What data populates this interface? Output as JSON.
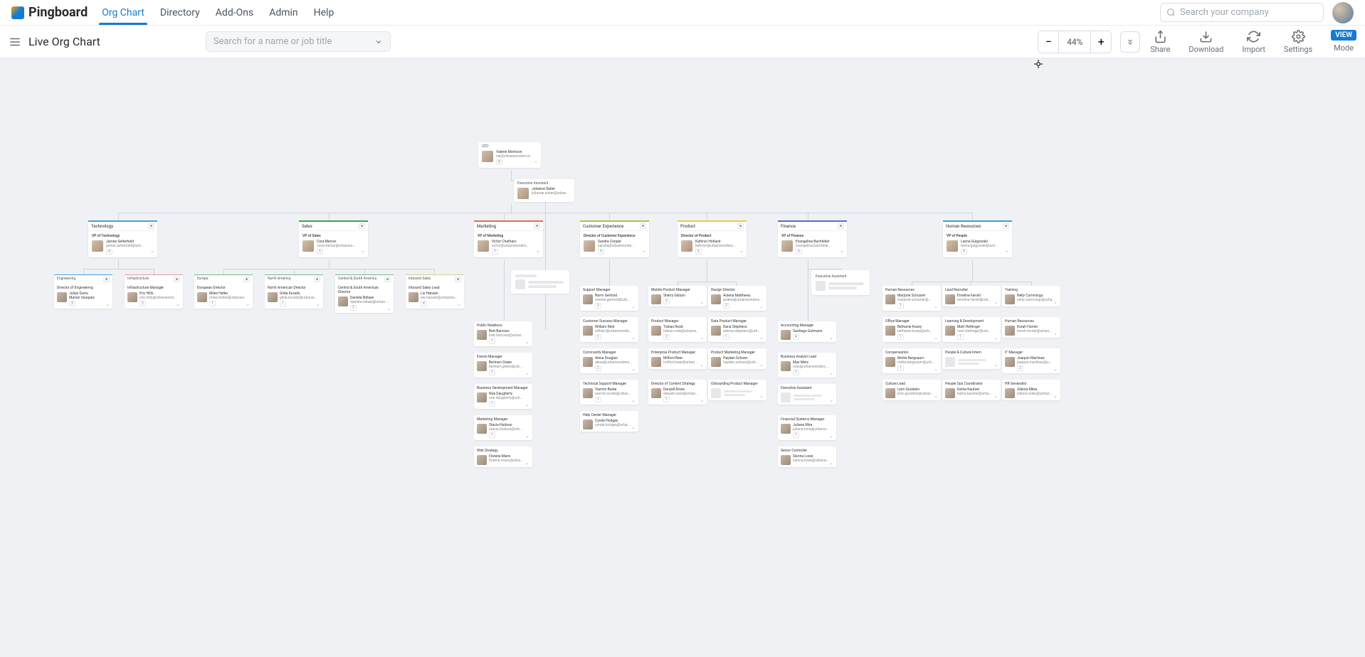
{
  "app": {
    "name": "Pingboard"
  },
  "nav": {
    "links": [
      "Org Chart",
      "Directory",
      "Add-Ons",
      "Admin",
      "Help"
    ],
    "search_placeholder": "Search your company"
  },
  "toolbar": {
    "title": "Live Org Chart",
    "search_placeholder": "Search for a name or job title",
    "zoom": "44%",
    "actions": {
      "share": "Share",
      "download": "Download",
      "import": "Import",
      "settings": "Settings",
      "mode": "Mode",
      "mode_badge": "VIEW"
    }
  },
  "ceo": {
    "dept": "CEO",
    "name": "Valerie Morrison",
    "email": "val@urbanwonders.io",
    "count": "8"
  },
  "ea": {
    "title": "Executive Assistant",
    "name": "Julianne Slater",
    "email": "julianne.slater@urban..."
  },
  "depts": [
    {
      "key": "technology",
      "label": "Technology",
      "color": "#3ca5e6",
      "title": "VP of Technology",
      "name": "James Setterfield",
      "email": "james.setterfield@urb...",
      "count": "4"
    },
    {
      "key": "sales",
      "label": "Sales",
      "color": "#33a852",
      "title": "VP of Sales",
      "name": "Cora Mercer",
      "email": "cora.mercer@urbanwo...",
      "count": "5"
    },
    {
      "key": "marketing",
      "label": "Marketing",
      "color": "#e96b4a",
      "title": "VP of Marketing",
      "name": "Victor Chatham",
      "email": "victor@urbanwonders...",
      "count": "7"
    },
    {
      "key": "cx",
      "label": "Customer Experience",
      "color": "#a7c83c",
      "title": "Director of Customer Experience",
      "name": "Sandra Cooper",
      "email": "sandra@urbanwonde...",
      "count": "5"
    },
    {
      "key": "product",
      "label": "Product",
      "color": "#f3c63b",
      "title": "Director of Product",
      "name": "Kathryn Holland",
      "email": "kathryn@urbanwonders...",
      "count": "6"
    },
    {
      "key": "finance",
      "label": "Finance",
      "color": "#4f6fd8",
      "title": "VP of Finance",
      "name": "Evangelina Bachfeller",
      "email": "evangelina.bachfelle...",
      "count": "5"
    },
    {
      "key": "hr",
      "label": "Human Resources",
      "color": "#39a0d8",
      "title": "VP of People",
      "name": "Leona Gulgowski",
      "email": "leona.gulgowski@urb...",
      "count": "9"
    }
  ],
  "tech_subs": [
    {
      "label": "Engineering",
      "color": "#3ca5e6",
      "title": "Director of Engineering",
      "name": "Julian Davis",
      "name2": "Marian Vasquez",
      "count": "3"
    },
    {
      "label": "Infrastructure",
      "color": "#e29aa8",
      "title": "Infrastructure Manager",
      "name": "Eric Hills",
      "email": "eric.hills@urbanwond...",
      "count": "2"
    }
  ],
  "sales_subs": [
    {
      "label": "Europe",
      "color": "#6bc084",
      "title": "European Director",
      "name": "Miles Heller",
      "email": "miles.heller@urbanwo",
      "count": "1"
    },
    {
      "label": "North America",
      "color": "#6ebc8c",
      "title": "North American Director",
      "name": "Gilda Kuvalis",
      "email": "gilda.kuvalis@urbanw...",
      "count": "1"
    },
    {
      "label": "Central & South America",
      "color": "#6ebc8c",
      "title": "Central & South American Director",
      "name": "Daniela Ndiaye",
      "email": "daniela.ndiaye@urban...",
      "count": "2"
    },
    {
      "label": "Inbound Sales",
      "color": "#d8ce8a",
      "title": "Inbound Sales Lead",
      "name": "Liz Hansen",
      "email": "ela.hansen@urbanwo...",
      "count": "4"
    }
  ],
  "marketing_subs": [
    {
      "title": "Public Relations",
      "name": "Bret Barrows",
      "email": "bret.barrows@urban...",
      "count": "1"
    },
    {
      "title": "Events Manager",
      "name": "Bertram Green",
      "email": "bertram.green@urb...",
      "count": "1"
    },
    {
      "title": "Business Development Manager",
      "name": "Noe Daugherty",
      "email": "noe.daugherty@urb...",
      "count": "1"
    },
    {
      "title": "Marketing Manager",
      "name": "Stacia Hudson",
      "email": "stacia.hudson@urb...",
      "count": "1"
    },
    {
      "title": "Web Strategy",
      "name": "Florene Mann",
      "email": "florene.mann@urba..."
    }
  ],
  "cx_subs": [
    {
      "title": "Support Manager",
      "name": "Norm Gerhold",
      "email": "nomen.gerhold@urb...",
      "count": "3"
    },
    {
      "title": "Customer Success Manager",
      "name": "William Reid",
      "email": "william@urbanwonde...",
      "count": "2"
    },
    {
      "title": "Community Manager",
      "name": "Alexa Douglas",
      "email": "alexa@urbanwonders...",
      "count": "2"
    },
    {
      "title": "Technical Support Manager",
      "name": "Yazmin Burke",
      "email": "yazmin.burke@urban...",
      "count": "1"
    },
    {
      "title": "Help Center Manager",
      "name": "Cynde Hodges",
      "email": "cynde.hodges@urba..."
    }
  ],
  "product_subs": [
    {
      "title": "Mobile Product Manager",
      "name": "Sherry Gibson",
      "count": "2"
    },
    {
      "title": "Product Manager",
      "name": "Tobias Roob",
      "email": "tobias.roob@urbanw...",
      "count": "2"
    },
    {
      "title": "Enterprise Product Manager",
      "name": "Milford Beer",
      "email": "milford.beer@urban..."
    },
    {
      "title": "Director of Content Strategy",
      "name": "Danyell Rowe",
      "email": "danyell.rowe@urban...",
      "count": "1"
    }
  ],
  "product_subs_r": [
    {
      "title": "Design Director",
      "name": "Aulena Matthews",
      "email": "aulena@urbanwonders...",
      "count": "3"
    },
    {
      "title": "Data Product Manager",
      "name": "Dana Stephens",
      "email": "adenia.stephens@urb...",
      "count": "1"
    },
    {
      "title": "Product Marketing Manager",
      "name": "Hayden Schoen",
      "email": "hayden.schoen@urb..."
    },
    {
      "title": "Onboarding Product Manager"
    }
  ],
  "finance_subs": [
    {
      "title": "Accounting Manager",
      "name": "Santiago Gutmann",
      "name2": "",
      "count": "4"
    },
    {
      "title": "Business Analyst Lead",
      "name": "Max Metz",
      "email": "max@urbanwonders....",
      "count": "1"
    },
    {
      "title": "Executive Assistant"
    },
    {
      "title": "Financial Systems Manager",
      "name": "Juliana Mira",
      "email": "juliana.mira@urbanw...",
      "count": "1"
    },
    {
      "title": "Senior Controller",
      "name": "Sienna Lowe",
      "email": "sienna.lowe@urbanw..."
    }
  ],
  "finance_ea": {
    "title": "Executive Assistant"
  },
  "hr_subs": [
    {
      "title": "Human Resources",
      "name": "Marjorie Schuster",
      "email": "marjorie.schuster@...",
      "count": "1"
    },
    {
      "title": "Office Manager",
      "name": "Bethanie Kozey",
      "email": "bethanie.kozey@urb...",
      "count": "1"
    },
    {
      "title": "Compensation",
      "name": "Mollie Bergnaum",
      "email": "mella.bergnaum@urb...",
      "count": "1"
    },
    {
      "title": "Culture Lead",
      "name": "Lynn Goodwin",
      "email": "lynn.goodwin@urban..."
    }
  ],
  "hr_subs_c": [
    {
      "title": "Lead Recruiter",
      "name": "Emeline Farrell",
      "email": "emeline.farrell@urb..."
    },
    {
      "title": "Learning & Development",
      "name": "Matt Hettinger",
      "email": "mert.hettinger@urb...",
      "count": "1"
    },
    {
      "title": "People & Culture Intern"
    },
    {
      "title": "People Ops Coordinator",
      "name": "Katira Kautzer",
      "email": "katira.kautzer@urba..."
    }
  ],
  "hr_subs_r": [
    {
      "title": "Training",
      "name": "Nelly Cummings",
      "email": "nelly.cummings@urba..."
    },
    {
      "title": "Human Resources",
      "name": "Korah Hunter",
      "email": "korah.hunter@urban..."
    },
    {
      "title": "IT Manager",
      "name": "Joaquin Martinez",
      "email": "joaquin.martinez@u...",
      "count": "2"
    },
    {
      "title": "HR Generalist",
      "name": "Zekora Miles",
      "email": "zekora.miles@urban..."
    }
  ]
}
